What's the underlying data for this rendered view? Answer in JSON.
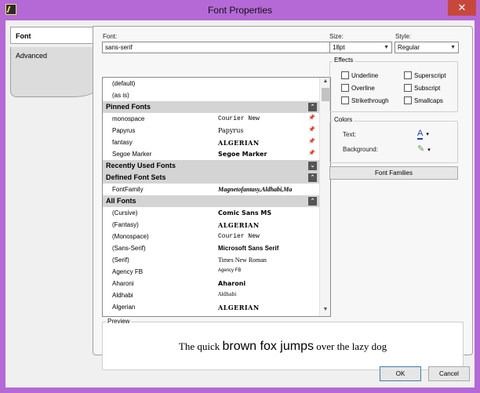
{
  "window": {
    "title": "Font Properties",
    "close_glyph": "✕"
  },
  "tabs": [
    {
      "label": "Font"
    },
    {
      "label": "Advanced"
    }
  ],
  "font": {
    "label": "Font:",
    "value": "sans-serif"
  },
  "size": {
    "label": "Size:",
    "value": "18pt"
  },
  "style": {
    "label": "Style:",
    "value": "Regular"
  },
  "font_list": {
    "rows": [
      {
        "kind": "item",
        "name": "(default)",
        "preview": ""
      },
      {
        "kind": "item",
        "name": "(as is)",
        "preview": ""
      },
      {
        "kind": "group",
        "name": "Pinned Fonts",
        "glyph": "⌃"
      },
      {
        "kind": "item",
        "name": "monospace",
        "preview": "Courier New",
        "pinned": true
      },
      {
        "kind": "item",
        "name": "Papyrus",
        "preview": "Papyrus",
        "pinned": true
      },
      {
        "kind": "item",
        "name": "fantasy",
        "preview": "ALGERIAN",
        "pinned": true
      },
      {
        "kind": "item",
        "name": "Segoe Marker",
        "preview": "Segoe Marker",
        "pinned": true
      },
      {
        "kind": "group",
        "name": "Recently Used Fonts",
        "glyph": "⌄"
      },
      {
        "kind": "group",
        "name": "Defined Font Sets",
        "glyph": "⌃"
      },
      {
        "kind": "item",
        "name": "FontFamily",
        "preview": "Magnetofantasy,Aldhabi,Ma"
      },
      {
        "kind": "group",
        "name": "All Fonts",
        "glyph": "⌃"
      },
      {
        "kind": "item",
        "name": "(Cursive)",
        "preview": "Comic Sans MS"
      },
      {
        "kind": "item",
        "name": "(Fantasy)",
        "preview": "ALGERIAN"
      },
      {
        "kind": "item",
        "name": "(Monospace)",
        "preview": "Courier New"
      },
      {
        "kind": "item",
        "name": "(Sans-Serif)",
        "preview": "Microsoft Sans Serif"
      },
      {
        "kind": "item",
        "name": "(Serif)",
        "preview": "Times New Roman"
      },
      {
        "kind": "item",
        "name": "Agency FB",
        "preview": "Agency FB"
      },
      {
        "kind": "item",
        "name": "Aharoni",
        "preview": "Aharoni"
      },
      {
        "kind": "item",
        "name": "Aldhabi",
        "preview": "Aldhabi"
      },
      {
        "kind": "item",
        "name": "Algerian",
        "preview": "ALGERIAN"
      }
    ]
  },
  "effects": {
    "title": "Effects",
    "options": [
      {
        "label": "Underline",
        "checked": false
      },
      {
        "label": "Superscript",
        "checked": false
      },
      {
        "label": "Overline",
        "checked": false
      },
      {
        "label": "Subscript",
        "checked": false
      },
      {
        "label": "Strikethrough",
        "checked": false
      },
      {
        "label": "Smallcaps",
        "checked": false
      }
    ]
  },
  "colors": {
    "title": "Colors",
    "text_label": "Text:",
    "background_label": "Background:",
    "text_color": "#1f3fbf",
    "background_color": "#5aa04a"
  },
  "font_families_button": "Font Families",
  "preview": {
    "title": "Preview",
    "part1": "The quick ",
    "part2": "brown fox jumps",
    "part3": " over the lazy dog"
  },
  "buttons": {
    "ok": "OK",
    "cancel": "Cancel"
  },
  "accent": "#b569d6"
}
